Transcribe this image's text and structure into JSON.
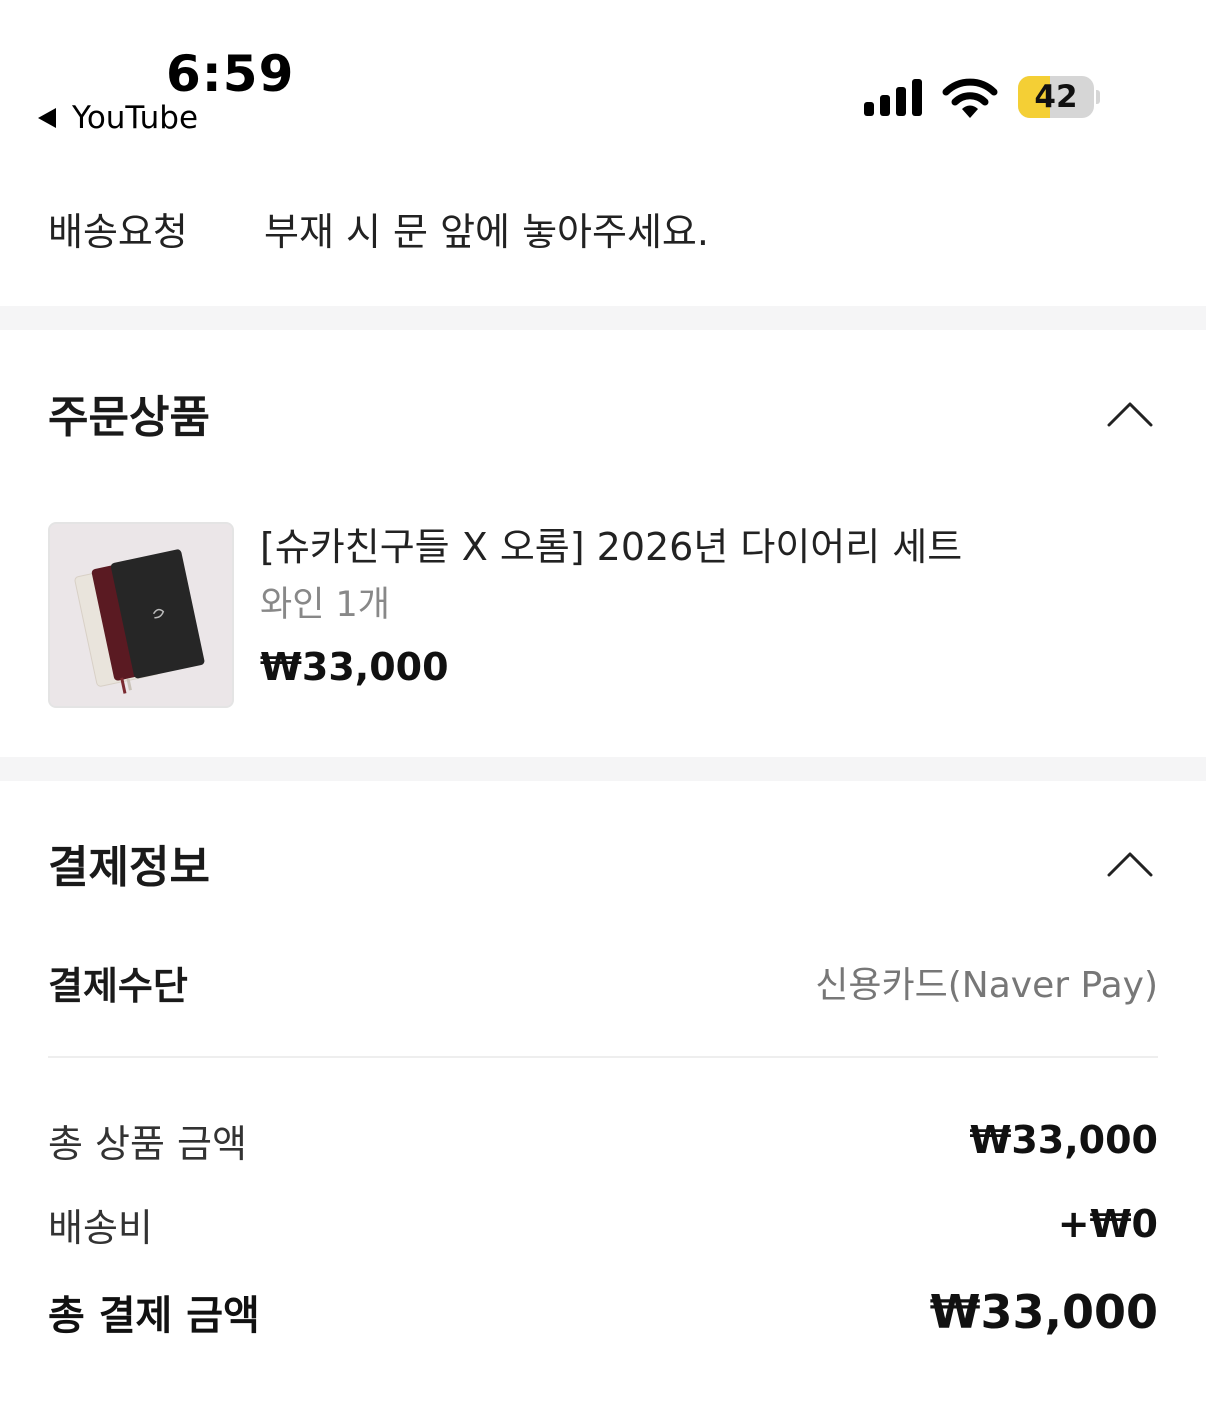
{
  "status_bar": {
    "time": "6:59",
    "back_app": "YouTube",
    "battery_level": "42",
    "battery_fraction": 0.42,
    "signal_bars": 4
  },
  "delivery": {
    "label": "배송요청",
    "value": "부재 시 문 앞에 놓아주세요."
  },
  "order_items": {
    "title": "주문상품",
    "items": [
      {
        "name": "[슈카친구들 X 오롬] 2026년 다이어리 세트",
        "option": "와인 1개",
        "price": "₩33,000"
      }
    ]
  },
  "payment_info": {
    "title": "결제정보",
    "method_label": "결제수단",
    "method_value": "신용카드(Naver Pay)",
    "subtotal_label": "총 상품 금액",
    "subtotal_value": "₩33,000",
    "shipping_label": "배송비",
    "shipping_value": "+₩0",
    "total_label": "총 결제 금액",
    "total_value": "₩33,000"
  },
  "colors": {
    "battery_fill": "#f4cf35",
    "divider_band": "#f5f5f6",
    "muted_text": "#888888"
  }
}
